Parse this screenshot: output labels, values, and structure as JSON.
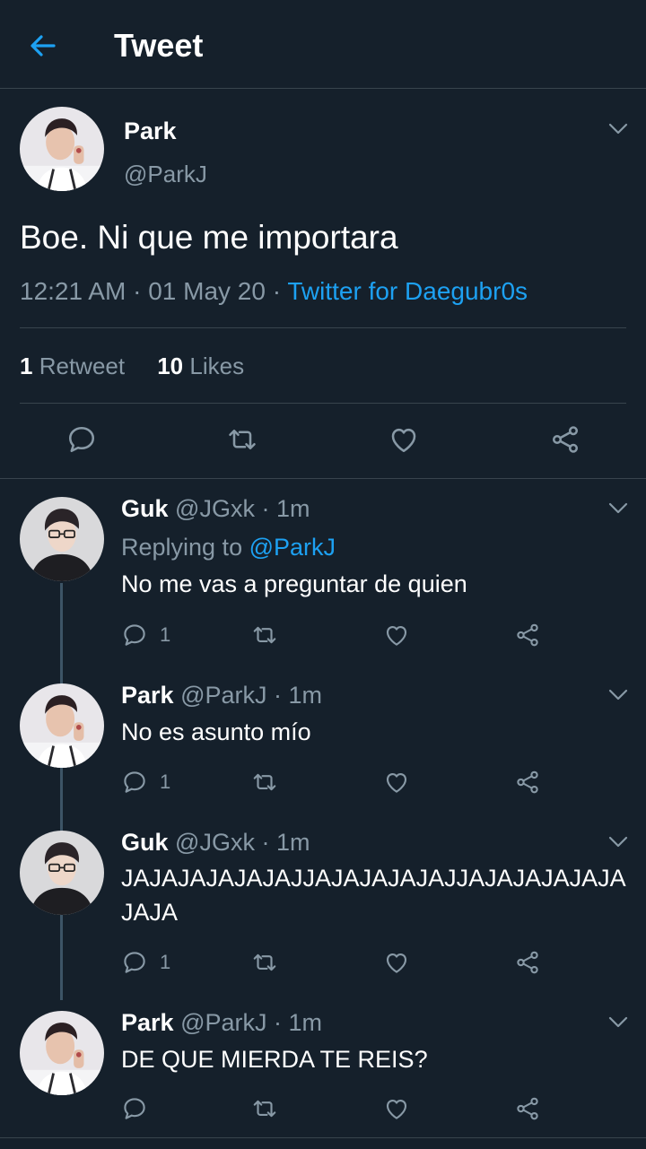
{
  "header": {
    "title": "Tweet",
    "back_icon": "arrow-left-icon"
  },
  "colors": {
    "background": "#15202b",
    "accent": "#1da1f2",
    "muted": "#8899a6",
    "divider": "#38444d"
  },
  "main_tweet": {
    "name": "Park",
    "handle": "@ParkJ",
    "text": "Boe. Ni que me importara",
    "time": "12:21 AM",
    "date": "01 May 20",
    "source": "Twitter for Daegubr0s",
    "sep": "·",
    "retweets_count": "1",
    "retweets_label": "Retweet",
    "likes_count": "10",
    "likes_label": "Likes"
  },
  "replies": [
    {
      "name": "Guk",
      "handle": "@JGxk",
      "time": "1m",
      "replying_label": "Replying to",
      "replying_to": "@ParkJ",
      "text": "No me vas a preguntar de quien",
      "reply_count": "1"
    },
    {
      "name": "Park",
      "handle": "@ParkJ",
      "time": "1m",
      "text": "No es asunto mío",
      "reply_count": "1"
    },
    {
      "name": "Guk",
      "handle": "@JGxk",
      "time": "1m",
      "text": "JAJAJAJAJAJAJJAJAJAJAJAJJAJAJAJAJAJAJAJA",
      "reply_count": "1"
    },
    {
      "name": "Park",
      "handle": "@ParkJ",
      "time": "1m",
      "text": "DE QUE MIERDA TE REIS?",
      "reply_count": ""
    }
  ],
  "action_icons": [
    "reply-icon",
    "retweet-icon",
    "like-icon",
    "share-icon"
  ]
}
